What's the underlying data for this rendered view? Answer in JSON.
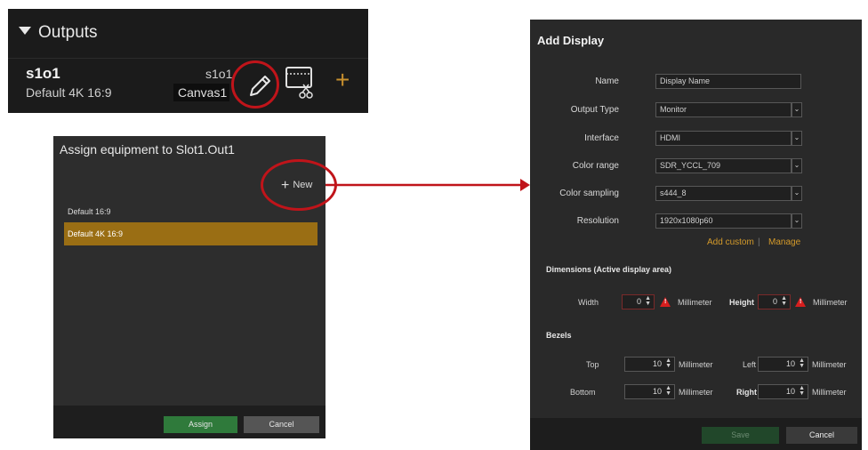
{
  "outputs": {
    "header": "Outputs",
    "output_name": "s1o1",
    "output_desc": "Default 4K 16:9",
    "right_name": "s1o1",
    "canvas": "Canvas1",
    "icons": {
      "edit": "pencil-icon",
      "screen": "screen-scissors-icon",
      "add": "plus-icon"
    },
    "accent_color": "#c8902e"
  },
  "assign": {
    "title": "Assign equipment to Slot1.Out1",
    "new_button": "New",
    "items": [
      "Default 16:9",
      "Default 4K 16:9"
    ],
    "selected_index": 1,
    "assign_button": "Assign",
    "cancel_button": "Cancel"
  },
  "add_display": {
    "title": "Add Display",
    "fields": {
      "name_label": "Name",
      "name_value": "Display Name",
      "output_type_label": "Output Type",
      "output_type_value": "Monitor",
      "interface_label": "Interface",
      "interface_value": "HDMI",
      "color_range_label": "Color range",
      "color_range_value": "SDR_YCCL_709",
      "color_sampling_label": "Color sampling",
      "color_sampling_value": "s444_8",
      "resolution_label": "Resolution",
      "resolution_value": "1920x1080p60"
    },
    "add_custom": "Add custom",
    "manage": "Manage",
    "dimensions": {
      "section": "Dimensions (Active display area)",
      "width_label": "Width",
      "width_value": "0",
      "unit": "Millimeter",
      "height_label": "Height",
      "height_value": "0"
    },
    "bezels": {
      "section": "Bezels",
      "top_label": "Top",
      "top_value": "10",
      "left_label": "Left",
      "left_value": "10",
      "bottom_label": "Bottom",
      "bottom_value": "10",
      "right_label": "Right",
      "right_value": "10",
      "unit": "Millimeter"
    },
    "save_button": "Save",
    "cancel_button": "Cancel"
  },
  "colors": {
    "highlight_red": "#c0141a",
    "selected_item": "#9a6e14",
    "assign_green": "#2f7a3b",
    "link_orange": "#d49a2a"
  }
}
